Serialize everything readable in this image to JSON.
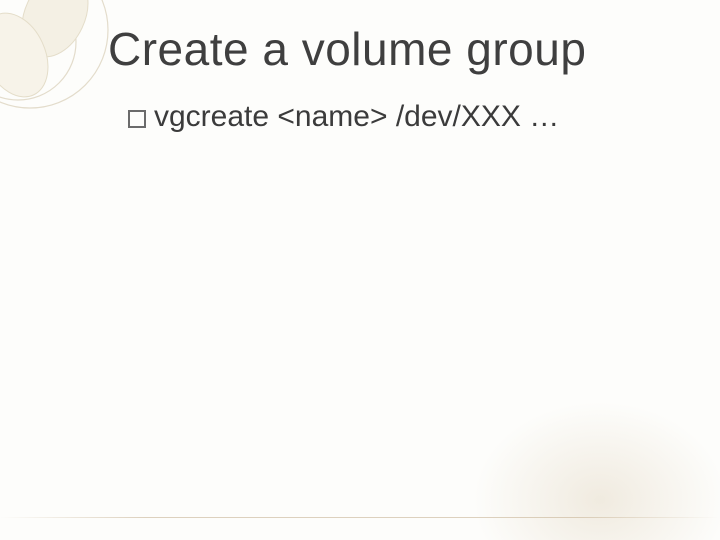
{
  "slide": {
    "title": "Create a volume group",
    "bullets": [
      {
        "text": "vgcreate <name> /dev/XXX …"
      }
    ]
  }
}
